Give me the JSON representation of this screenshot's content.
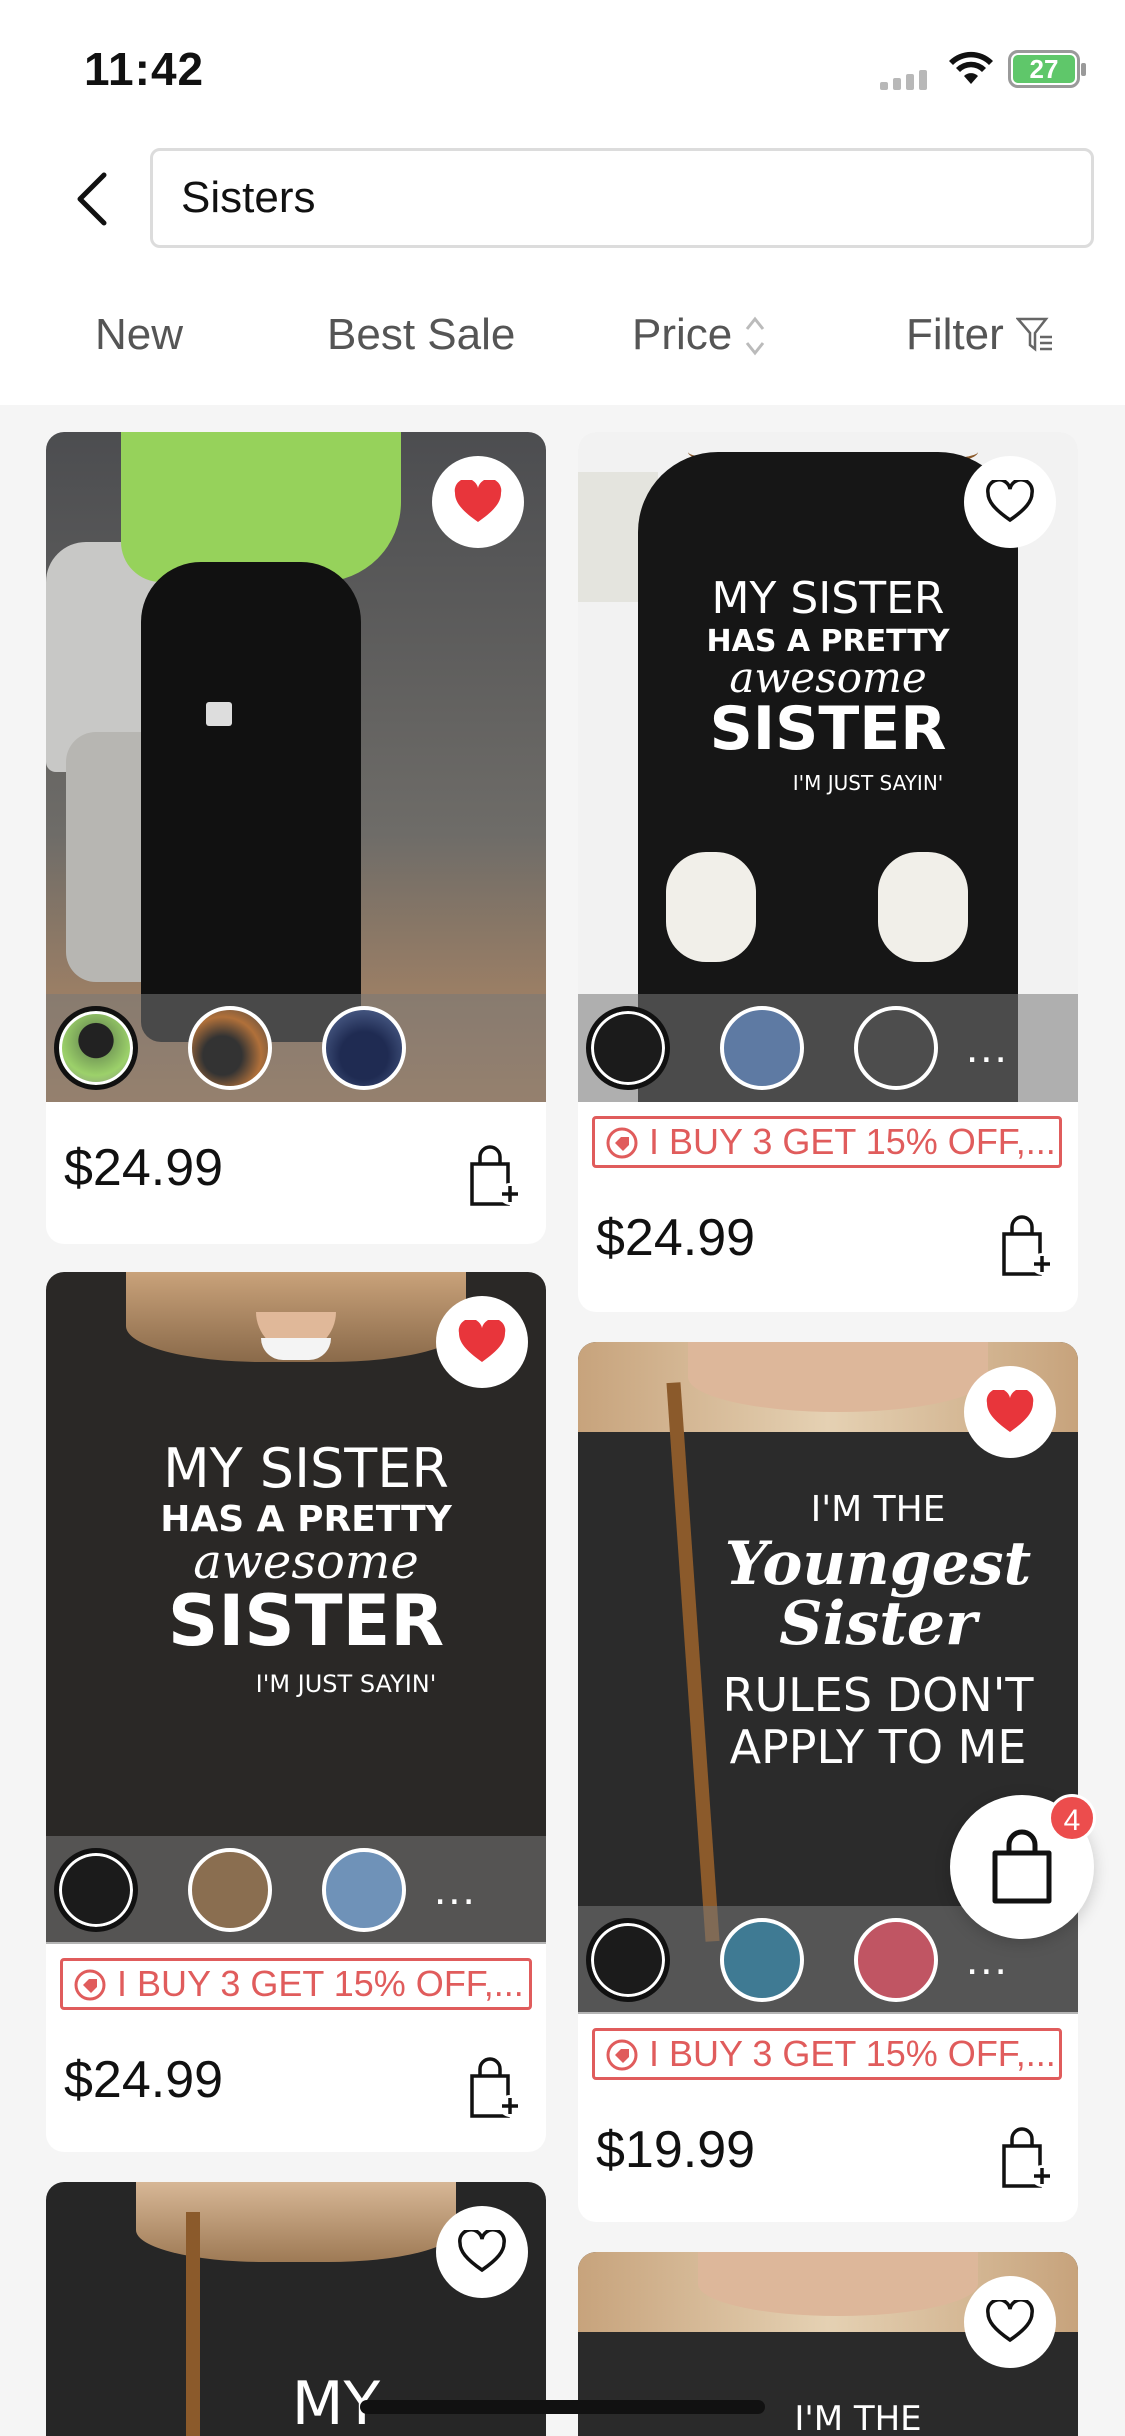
{
  "status_bar": {
    "time": "11:42",
    "battery": "27"
  },
  "search": {
    "value": "Sisters"
  },
  "sort_tabs": {
    "new": "New",
    "best_sale": "Best Sale",
    "price": "Price",
    "filter": "Filter"
  },
  "products": [
    {
      "price": "$24.99",
      "favorited": true,
      "promo": ""
    },
    {
      "price": "$24.99",
      "favorited": false,
      "promo": "I BUY 3 GET 15% OFF,..."
    },
    {
      "price": "$24.99",
      "favorited": true,
      "promo": "I BUY 3 GET 15% OFF,..."
    },
    {
      "price": "$19.99",
      "favorited": true,
      "promo": "I BUY 3 GET 15% OFF,..."
    }
  ],
  "artwork": {
    "sweater_1": [
      "MY SISTER",
      "HAS A PRETTY",
      "awesome",
      "SISTER",
      "I'M JUST SAYIN'"
    ],
    "sweater_2": [
      "I'M THE",
      "Youngest",
      "Sister",
      "RULES DON'T",
      "APPLY TO ME"
    ],
    "sweater_peek_left": "MY SISTER",
    "sweater_peek_right": "I'M THE"
  },
  "more_label": "...",
  "cart": {
    "count": "4"
  },
  "colors": {
    "accent_red": "#e05c5c",
    "badge_red": "#ec4d4d",
    "heart_red": "#e8353b"
  }
}
